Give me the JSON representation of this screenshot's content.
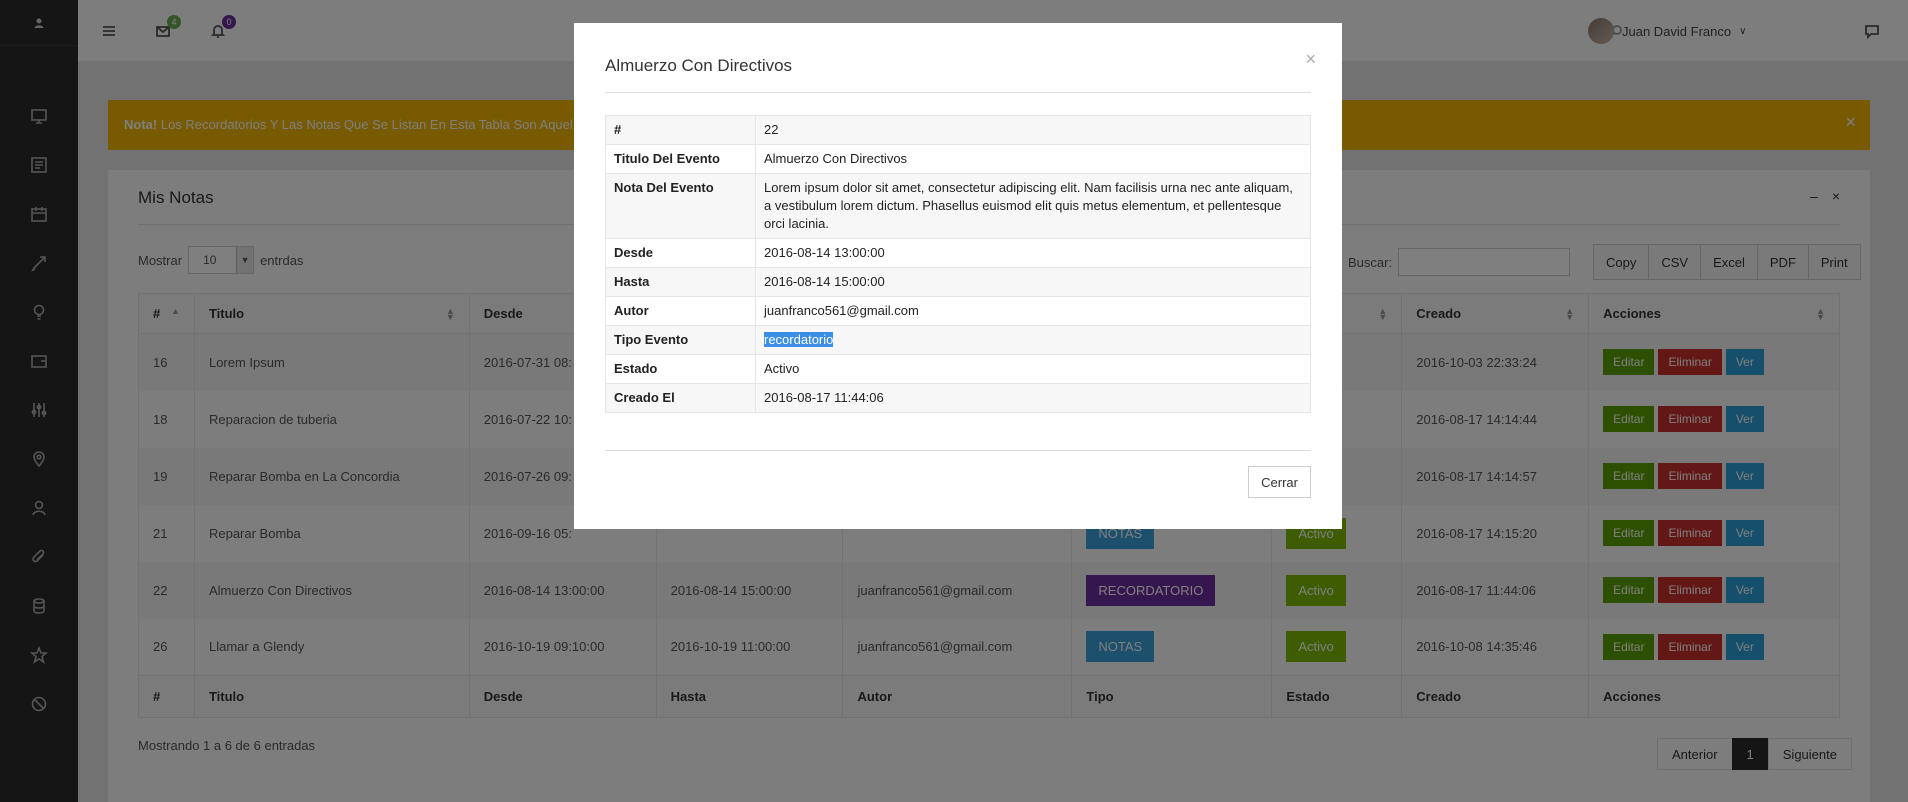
{
  "topbar": {
    "mail_badge": "4",
    "bell_badge": "0",
    "user_name": "Juan David Franco",
    "mail_badge_color": "#6aa84f",
    "bell_badge_color": "#6a2c9c"
  },
  "alert": {
    "bold": "Nota!",
    "text": "Los Recordatorios Y Las Notas Que Se Listan En Esta Tabla Son Aquel",
    "close": "×"
  },
  "panel": {
    "title": "Mis Notas",
    "minimize": "–",
    "close": "×",
    "show_label": "Mostrar",
    "show_value": "10",
    "entries_label": "entrdas",
    "search_label": "Buscar:",
    "export_buttons": [
      "Copy",
      "CSV",
      "Excel",
      "PDF",
      "Print"
    ]
  },
  "table": {
    "headers": [
      "#",
      "Titulo",
      "Desde",
      "Hasta",
      "Autor",
      "Tipo",
      "Estado",
      "Creado",
      "Acciones"
    ],
    "rows": [
      {
        "id": "16",
        "titulo": "Lorem Ipsum",
        "desde": "2016-07-31 08:",
        "hasta": "",
        "autor": "",
        "tipo": "",
        "tipo_class": "",
        "estado": "o",
        "estado_class": "tag-red",
        "creado": "2016-10-03 22:33:24"
      },
      {
        "id": "18",
        "titulo": "Reparacion de tuberia",
        "desde": "2016-07-22 10:",
        "hasta": "",
        "autor": "",
        "tipo": "",
        "tipo_class": "",
        "estado": "",
        "estado_class": "tag-act",
        "creado": "2016-08-17 14:14:44"
      },
      {
        "id": "19",
        "titulo": "Reparar Bomba en La Concordia",
        "desde": "2016-07-26 09:",
        "hasta": "",
        "autor": "",
        "tipo": "",
        "tipo_class": "",
        "estado": "",
        "estado_class": "tag-act",
        "creado": "2016-08-17 14:14:57"
      },
      {
        "id": "21",
        "titulo": "Reparar Bomba",
        "desde": "2016-09-16 05:",
        "hasta": "",
        "autor": "",
        "tipo": "NOTAS",
        "tipo_class": "tag-not",
        "estado": "Activo",
        "estado_class": "tag-act",
        "creado": "2016-08-17 14:15:20"
      },
      {
        "id": "22",
        "titulo": "Almuerzo Con Directivos",
        "desde": "2016-08-14 13:00:00",
        "hasta": "2016-08-14 15:00:00",
        "autor": "juanfranco561@gmail.com",
        "tipo": "RECORDATORIO",
        "tipo_class": "tag-rec",
        "estado": "Activo",
        "estado_class": "tag-act",
        "creado": "2016-08-17 11:44:06"
      },
      {
        "id": "26",
        "titulo": "Llamar a Glendy",
        "desde": "2016-10-19 09:10:00",
        "hasta": "2016-10-19 11:00:00",
        "autor": "juanfranco561@gmail.com",
        "tipo": "NOTAS",
        "tipo_class": "tag-not",
        "estado": "Activo",
        "estado_class": "tag-act",
        "creado": "2016-10-08 14:35:46"
      }
    ],
    "actions": [
      "Editar",
      "Eliminar",
      "Ver"
    ]
  },
  "footer": {
    "info": "Mostrando 1 a 6 de 6 entradas",
    "prev": "Anterior",
    "page": "1",
    "next": "Siguiente"
  },
  "modal": {
    "title": "Almuerzo Con Directivos",
    "close_x": "×",
    "rows": [
      {
        "k": "#",
        "v": "22"
      },
      {
        "k": "Titulo Del Evento",
        "v": "Almuerzo Con Directivos"
      },
      {
        "k": "Nota Del Evento",
        "v": "Lorem ipsum dolor sit amet, consectetur adipiscing elit. Nam facilisis urna nec ante aliquam, a vestibulum lorem dictum. Phasellus euismod elit quis metus elementum, et pellentesque orci lacinia."
      },
      {
        "k": "Desde",
        "v": "2016-08-14 13:00:00"
      },
      {
        "k": "Hasta",
        "v": "2016-08-14 15:00:00"
      },
      {
        "k": "Autor",
        "v": "juanfranco561@gmail.com"
      },
      {
        "k": "Tipo Evento",
        "v": "recordatorio",
        "selected": true
      },
      {
        "k": "Estado",
        "v": "Activo"
      },
      {
        "k": "Creado El",
        "v": "2016-08-17 11:44:06"
      }
    ],
    "close_button": "Cerrar"
  }
}
